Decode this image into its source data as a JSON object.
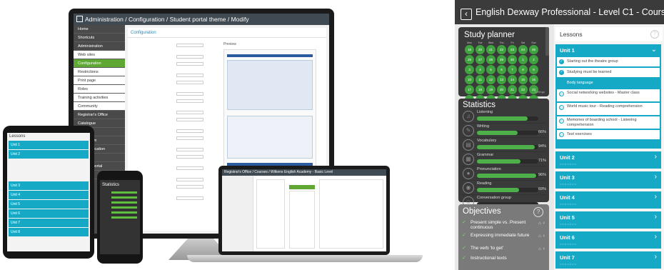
{
  "monitor": {
    "title": "Administration / Configuration / Student portal theme / Modify",
    "sidebar": [
      "Home",
      "Shortcuts",
      "Administration",
      "Web sites",
      "Configuration",
      "Restrictions",
      "Print page",
      "Roles",
      "Training activities",
      "Community",
      "Registrar's Office",
      "Catalogue",
      "Library",
      "Classroom",
      "Communication",
      "Help",
      "Student portal",
      "Log out"
    ],
    "main_heading": "Configuration",
    "preview_label": "Preview"
  },
  "laptop": {
    "title": "Registrar's Office / Courses / Wilkens English Academy - Basic Level"
  },
  "tablet": {
    "heading": "Lessons",
    "units": [
      "Unit 1",
      "Unit 2",
      "Unit 3",
      "Unit 4",
      "Unit 5",
      "Unit 6",
      "Unit 7",
      "Unit 8"
    ]
  },
  "phone": {
    "heading": "Statistics"
  },
  "app": {
    "title": "English Dexway Professional - Level C1 - Course 1",
    "study_planner": {
      "title": "Study planner",
      "days": [
        "Mon",
        "Tue",
        "Wed",
        "Thu",
        "Fri",
        "Sat",
        "Sun"
      ],
      "weeks": [
        [
          "19",
          "20",
          "21",
          "22",
          "23",
          "24",
          "25"
        ],
        [
          "26",
          "27",
          "28",
          "29",
          "30",
          "1",
          "2"
        ],
        [
          "3",
          "4",
          "5",
          "6",
          "7",
          "8",
          "9"
        ],
        [
          "10",
          "11",
          "12",
          "13",
          "14",
          "15",
          "16"
        ],
        [
          "17",
          "18",
          "19",
          "20",
          "21",
          "22",
          "23"
        ],
        [
          "24",
          "25",
          "26",
          "27",
          "28",
          "29",
          "30"
        ]
      ],
      "settings": "Settings"
    },
    "statistics": {
      "title": "Statistics",
      "items": [
        {
          "name": "Listening",
          "percent": "",
          "value": 0.82,
          "icon": "headphones-icon",
          "glyph": "♫"
        },
        {
          "name": "Writing",
          "percent": "66%",
          "value": 0.66,
          "icon": "pencil-icon",
          "glyph": "✎"
        },
        {
          "name": "Vocabulary",
          "percent": "94%",
          "value": 0.94,
          "icon": "book-icon",
          "glyph": "▤"
        },
        {
          "name": "Grammar",
          "percent": "71%",
          "value": 0.71,
          "icon": "grammar-icon",
          "glyph": "▦"
        },
        {
          "name": "Pronunciation",
          "percent": "96%",
          "value": 0.96,
          "icon": "microphone-icon",
          "glyph": "●"
        },
        {
          "name": "Reading",
          "percent": "69%",
          "value": 0.69,
          "icon": "eye-icon",
          "glyph": "◉"
        },
        {
          "name": "Conversation group",
          "percent": "",
          "value": 0.0,
          "icon": "chat-icon",
          "glyph": "☺"
        }
      ]
    },
    "objectives": {
      "title": "Objectives",
      "help": "?",
      "items": [
        "Present simple vs. Present continuous",
        "Expressing immediate future",
        "The verb 'to get'",
        "Instructional texts"
      ]
    },
    "lessons": {
      "title": "Lessons",
      "help": "?",
      "unit1": {
        "label": "Unit 1",
        "items": [
          {
            "text": "Starting out the theatre group",
            "state": "done"
          },
          {
            "text": "Studying must be learned",
            "state": "done"
          },
          {
            "text": "Body language",
            "state": "current"
          },
          {
            "text": "Social networking websites - Master class",
            "state": "play"
          },
          {
            "text": "World music tour - Reading comprehension",
            "state": "play"
          },
          {
            "text": "Memories of boarding school - Listening comprehension",
            "state": "play"
          },
          {
            "text": "Test exercises",
            "state": "play"
          }
        ]
      },
      "units": [
        "Unit 2",
        "Unit 3",
        "Unit 4",
        "Unit 5",
        "Unit 6",
        "Unit 7"
      ]
    },
    "colors": {
      "accent": "#16a9c6",
      "green": "#3fa43f",
      "dark": "#3a3a3a"
    }
  }
}
